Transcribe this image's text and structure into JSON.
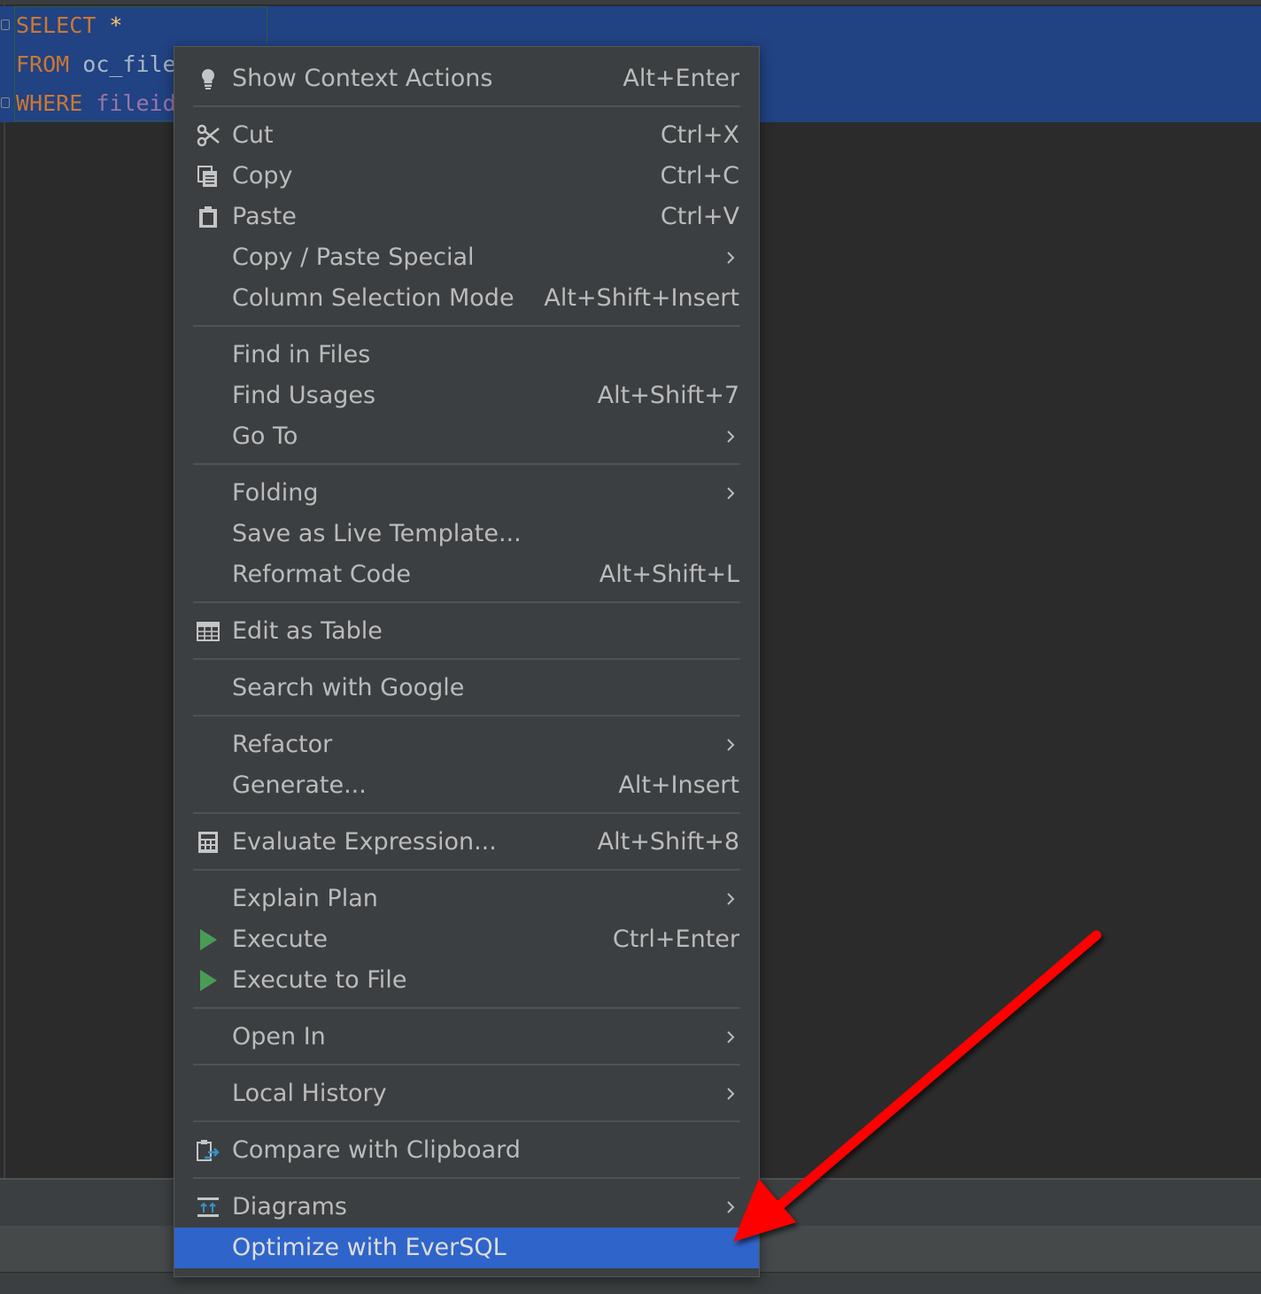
{
  "editor": {
    "lines": [
      {
        "keyword": "SELECT",
        "rest": "*",
        "rest_type": "star"
      },
      {
        "keyword": "FROM",
        "rest": "oc_file",
        "rest_type": "ident"
      },
      {
        "keyword": "WHERE",
        "rest": "fileid",
        "rest_type": "col"
      }
    ]
  },
  "menu": {
    "items": [
      {
        "label": "Show Context Actions",
        "shortcut": "Alt+Enter",
        "icon": "lightbulb-icon"
      },
      {
        "label": "Cut",
        "shortcut": "Ctrl+X",
        "icon": "scissors-icon"
      },
      {
        "label": "Copy",
        "shortcut": "Ctrl+C",
        "icon": "copy-icon"
      },
      {
        "label": "Paste",
        "shortcut": "Ctrl+V",
        "icon": "clipboard-icon"
      },
      {
        "label": "Copy / Paste Special",
        "shortcut": "",
        "submenu": true
      },
      {
        "label": "Column Selection Mode",
        "shortcut": "Alt+Shift+Insert"
      },
      {
        "label": "Find in Files",
        "shortcut": ""
      },
      {
        "label": "Find Usages",
        "shortcut": "Alt+Shift+7"
      },
      {
        "label": "Go To",
        "shortcut": "",
        "submenu": true
      },
      {
        "label": "Folding",
        "shortcut": "",
        "submenu": true
      },
      {
        "label": "Save as Live Template...",
        "shortcut": ""
      },
      {
        "label": "Reformat Code",
        "shortcut": "Alt+Shift+L"
      },
      {
        "label": "Edit as Table",
        "shortcut": "",
        "icon": "table-icon"
      },
      {
        "label": "Search with Google",
        "shortcut": ""
      },
      {
        "label": "Refactor",
        "shortcut": "",
        "submenu": true
      },
      {
        "label": "Generate...",
        "shortcut": "Alt+Insert"
      },
      {
        "label": "Evaluate Expression...",
        "shortcut": "Alt+Shift+8",
        "icon": "calculator-icon"
      },
      {
        "label": "Explain Plan",
        "shortcut": "",
        "submenu": true
      },
      {
        "label": "Execute",
        "shortcut": "Ctrl+Enter",
        "icon": "play-icon"
      },
      {
        "label": "Execute to File",
        "shortcut": "",
        "icon": "play-icon"
      },
      {
        "label": "Open In",
        "shortcut": "",
        "submenu": true
      },
      {
        "label": "Local History",
        "shortcut": "",
        "submenu": true
      },
      {
        "label": "Compare with Clipboard",
        "shortcut": "",
        "icon": "compare-clipboard-icon"
      },
      {
        "label": "Diagrams",
        "shortcut": "",
        "submenu": true,
        "icon": "diagram-icon"
      },
      {
        "label": "Optimize with EverSQL",
        "shortcut": "",
        "selected": true
      }
    ]
  },
  "colors": {
    "menu_bg": "#3c3f41",
    "selection_bg": "#2f65ca",
    "editor_selection": "#214283",
    "annotation_arrow": "#ff0000",
    "play_green": "#499c54"
  }
}
